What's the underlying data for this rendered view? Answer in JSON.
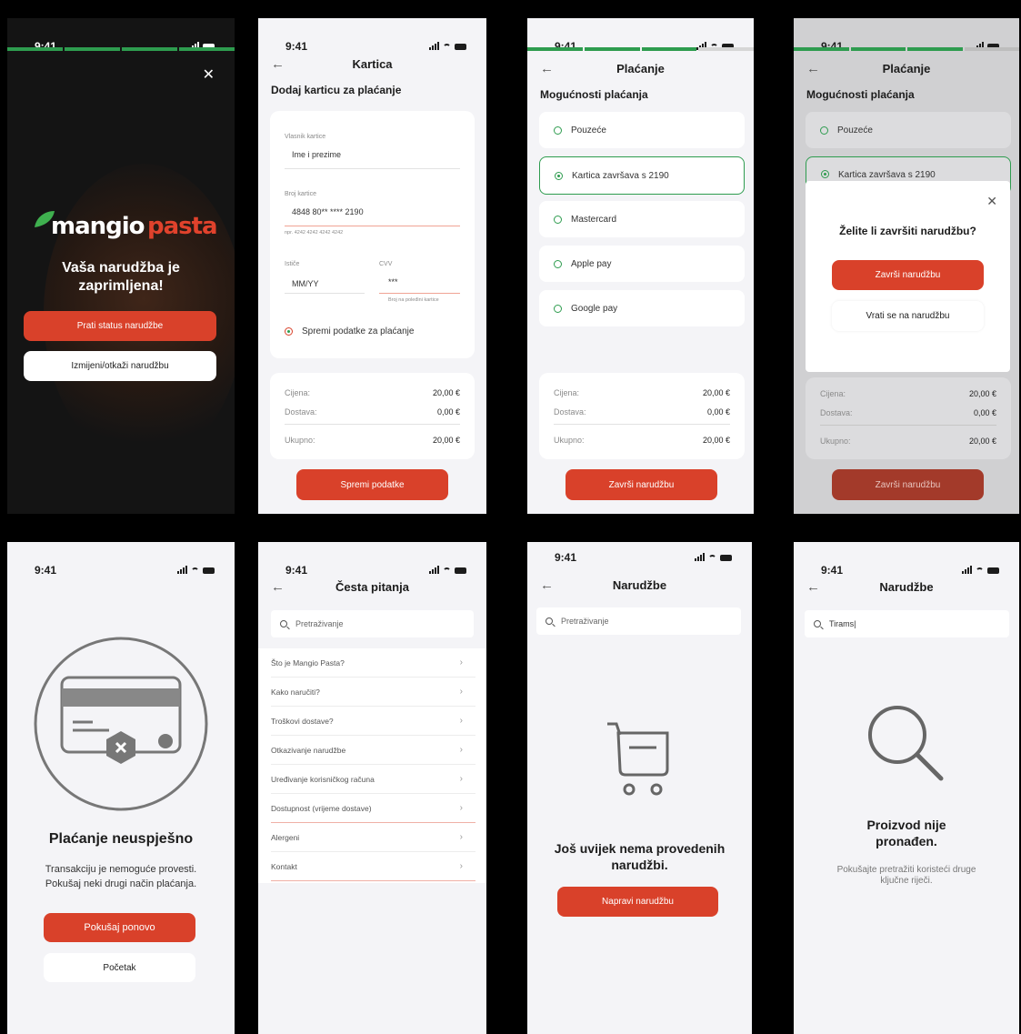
{
  "colors": {
    "brand_red": "#d9412a",
    "progress_green": "#2e9c4f",
    "progress_gray": "#d6d6d6"
  },
  "status_time": "9:41",
  "icons": {
    "signal": "signal-icon",
    "wifi": "wifi-icon",
    "battery": "battery-icon",
    "back": "arrow-left-icon",
    "close": "close-icon",
    "search": "search-icon",
    "chevron": "chevron-right-icon",
    "radio": "radio-icon",
    "card_failed": "credit-card-error-icon",
    "cart": "shopping-cart-icon",
    "magnifier": "magnifier-icon"
  },
  "s1": {
    "progress_segments": 4,
    "progress_done": 4,
    "close_glyph": "✕",
    "logo_word1": "mangio",
    "logo_word2": "pasta",
    "message": "Vaša narudžba je zaprimljena!",
    "track_button": "Prati status narudžbe",
    "edit_button": "Izmijeni/otkaži narudžbu"
  },
  "s2": {
    "back_glyph": "←",
    "title": "Kartica",
    "section": "Dodaj karticu za plaćanje",
    "owner_label": "Vlasnik kartice",
    "owner_value": "Ime i prezime",
    "number_label": "Broj kartice",
    "number_value": "4848 80** **** 2190",
    "number_hint": "npr. 4242 4242 4242 4242",
    "expiry_label": "Ističe",
    "expiry_value": "MM/YY",
    "cvv_label": "CVV",
    "cvv_value": "***",
    "cvv_hint": "Broj na poleđini kartice",
    "save_option": "Spremi podatke za plaćanje",
    "summary": {
      "price_label": "Cijena:",
      "price": "20,00 €",
      "delivery_label": "Dostava:",
      "delivery": "0,00 €",
      "total_label": "Ukupno:",
      "total": "20,00 €"
    },
    "button": "Spremi podatke"
  },
  "s3": {
    "progress_segments": 4,
    "progress_done": 3,
    "back_glyph": "←",
    "title": "Plaćanje",
    "section": "Mogućnosti plaćanja",
    "options": [
      "Pouzeće",
      "Kartica završava s 2190",
      "Mastercard",
      "Apple pay",
      "Google pay"
    ],
    "selected_index": 1,
    "summary": {
      "price_label": "Cijena:",
      "price": "20,00 €",
      "delivery_label": "Dostava:",
      "delivery": "0,00 €",
      "total_label": "Ukupno:",
      "total": "20,00 €"
    },
    "button": "Završi narudžbu"
  },
  "s4": {
    "progress_segments": 4,
    "progress_done": 3,
    "back_glyph": "←",
    "title": "Plaćanje",
    "section": "Mogućnosti plaćanja",
    "options": [
      "Pouzeće",
      "Kartica završava s 2190"
    ],
    "summary": {
      "price_label": "Cijena:",
      "price": "20,00 €",
      "delivery_label": "Dostava:",
      "delivery": "0,00 €",
      "total_label": "Ukupno:",
      "total": "20,00 €"
    },
    "button": "Završi narudžbu",
    "modal": {
      "close_glyph": "✕",
      "question": "Želite li završiti narudžbu?",
      "confirm": "Završi narudžbu",
      "cancel": "Vrati se na narudžbu"
    }
  },
  "s5": {
    "title": "Plaćanje neuspješno",
    "message": "Transakciju je nemoguće provesti. Pokušaj neki drugi način plaćanja.",
    "retry_button": "Pokušaj ponovo",
    "home_button": "Početak"
  },
  "s6": {
    "back_glyph": "←",
    "title": "Česta pitanja",
    "search_placeholder": "Pretraživanje",
    "chevron_glyph": "›",
    "items": [
      "Što je Mangio Pasta?",
      "Kako naručiti?",
      "Troškovi dostave?",
      "Otkazivanje narudžbe",
      "Uređivanje korisničkog računa",
      "Dostupnost (vrijeme dostave)",
      "Alergeni",
      "Kontakt"
    ]
  },
  "s7": {
    "back_glyph": "←",
    "title": "Narudžbe",
    "search_placeholder": "Pretraživanje",
    "message": "Još uvijek nema provedenih narudžbi.",
    "button": "Napravi narudžbu"
  },
  "s8": {
    "back_glyph": "←",
    "title": "Narudžbe",
    "search_value": "Tirams|",
    "message": "Proizvod nije pronađen.",
    "hint": "Pokušajte pretražiti koristeći druge ključne riječi."
  }
}
